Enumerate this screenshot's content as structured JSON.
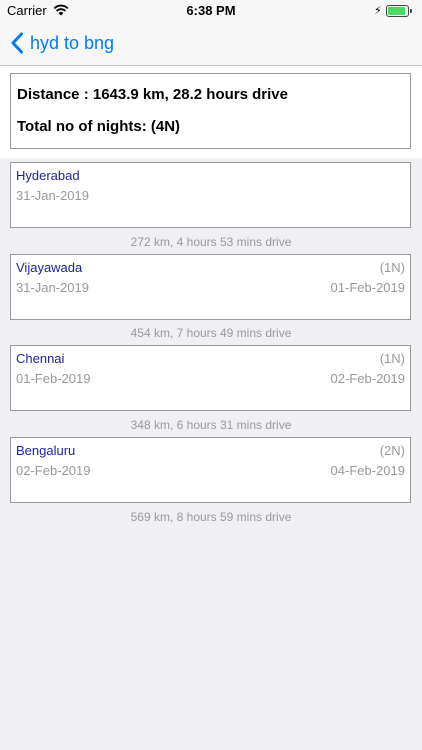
{
  "status_bar": {
    "carrier": "Carrier",
    "time": "6:38 PM",
    "icons": [
      "wifi-icon",
      "charging-bolt-icon",
      "battery-icon"
    ]
  },
  "nav": {
    "back_icon": "chevron-left-icon",
    "back_label": "hyd to bng",
    "accent": "#007aff"
  },
  "summary": {
    "distance_text": "Distance : 1643.9 km, 28.2 hours drive",
    "nights_text": "Total no of nights: (4N)"
  },
  "stops": [
    {
      "city": "Hyderabad",
      "nights": "",
      "arrive": "31-Jan-2019",
      "depart": ""
    },
    {
      "city": "Vijayawada",
      "nights": "(1N)",
      "arrive": "31-Jan-2019",
      "depart": "01-Feb-2019"
    },
    {
      "city": "Chennai",
      "nights": "(1N)",
      "arrive": "01-Feb-2019",
      "depart": "02-Feb-2019"
    },
    {
      "city": "Bengaluru",
      "nights": "(2N)",
      "arrive": "02-Feb-2019",
      "depart": "04-Feb-2019"
    }
  ],
  "legs": [
    "272 km, 4 hours 53 mins drive",
    "454 km, 7 hours 49 mins drive",
    "348 km, 6 hours 31 mins drive",
    "569 km, 8 hours 59 mins drive"
  ],
  "colors": {
    "city_text": "#1f1f9a",
    "muted_text": "#999999",
    "background": "#efeff4"
  }
}
